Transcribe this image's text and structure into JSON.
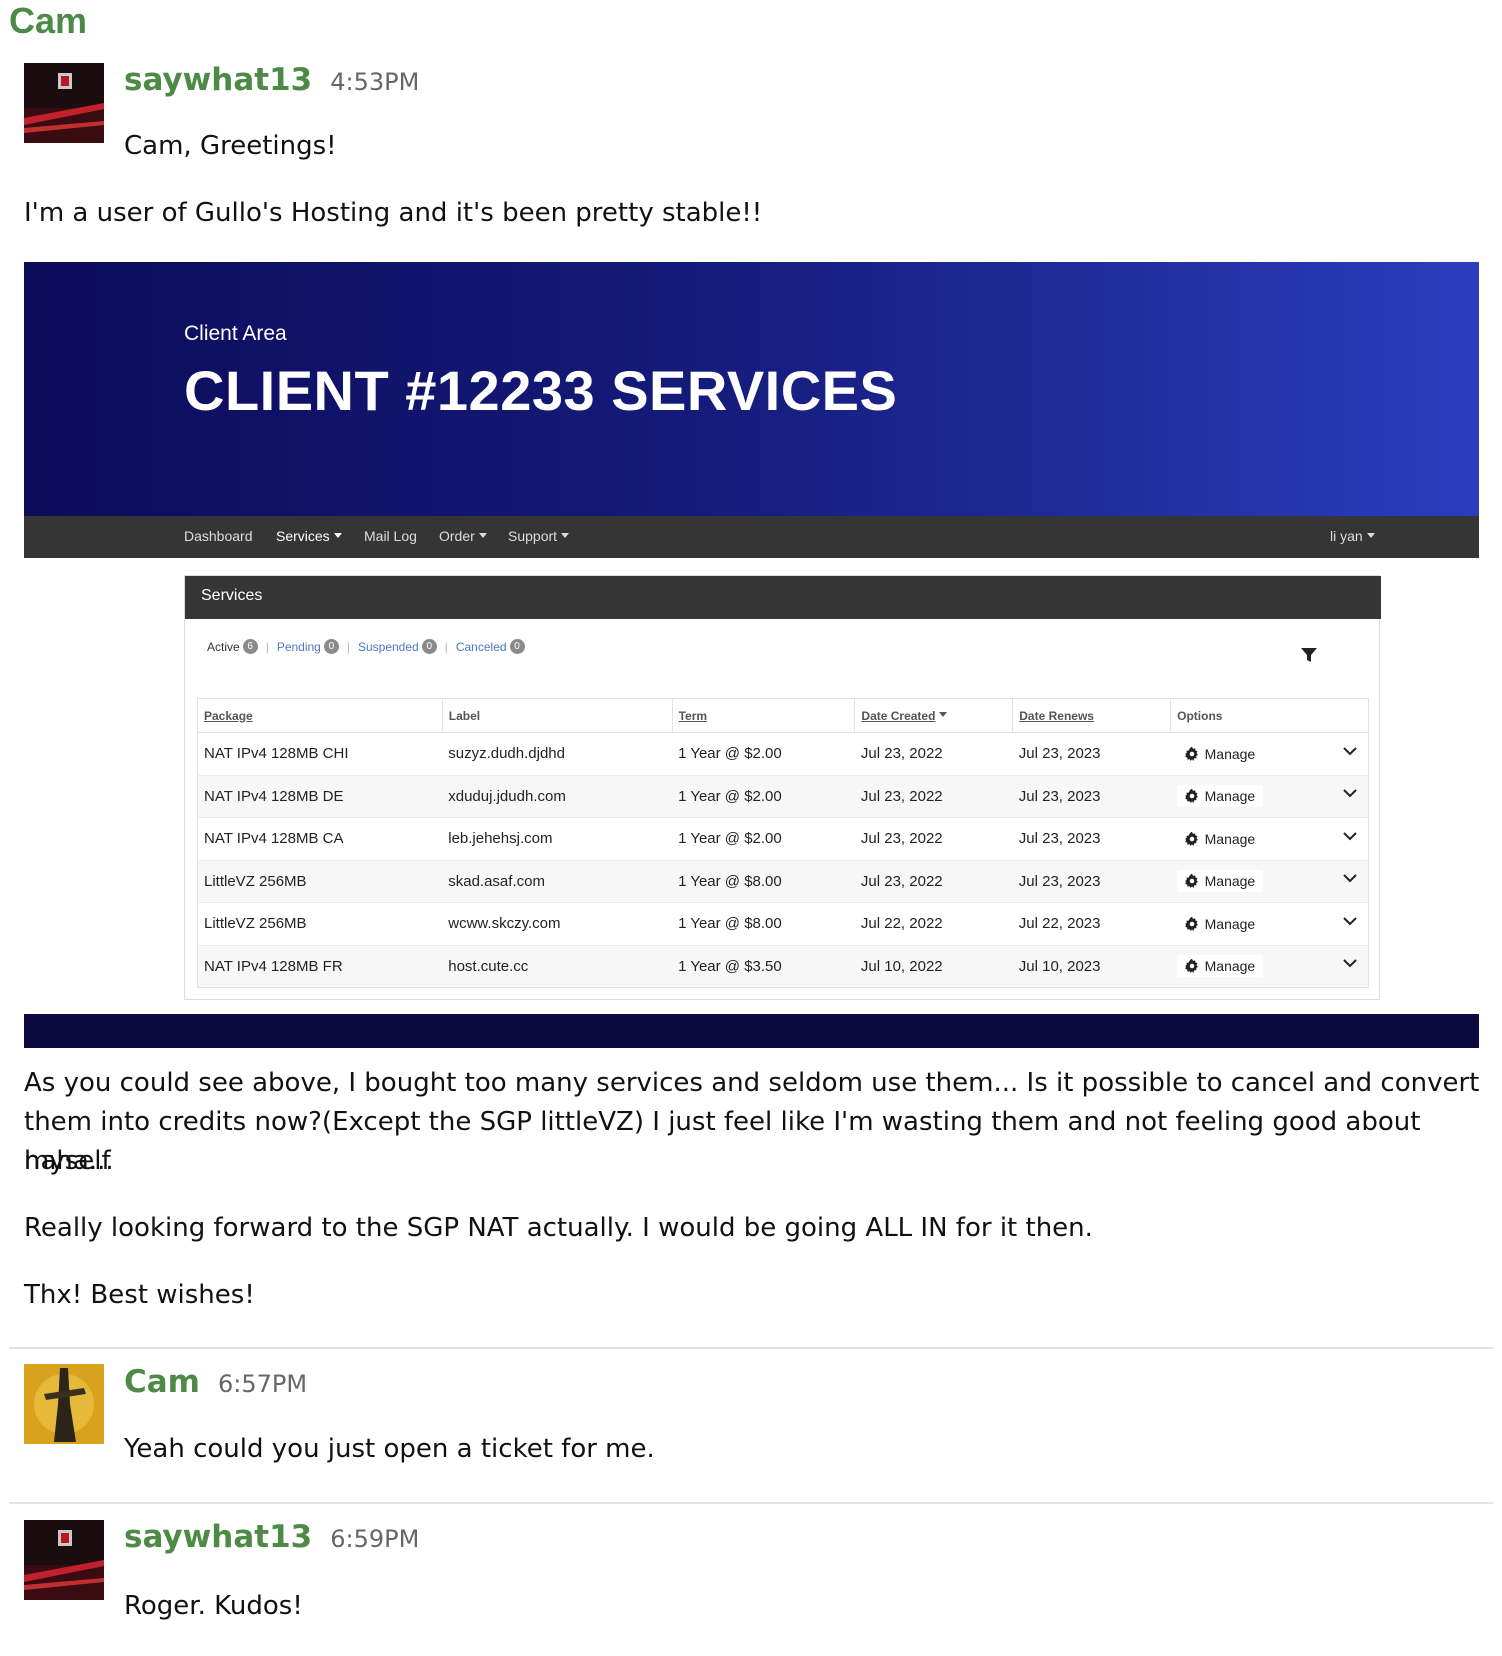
{
  "thread": {
    "title": "Cam"
  },
  "messages": [
    {
      "user": "saywhat13",
      "time": "4:53PM",
      "text": "Cam, Greetings!"
    },
    {
      "user": "Cam",
      "time": "6:57PM",
      "text": "Yeah could you just open a ticket for me."
    },
    {
      "user": "saywhat13",
      "time": "6:59PM",
      "text": "Roger. Kudos!"
    }
  ],
  "paragraphs": {
    "intro": "I'm a user of Gullo's Hosting and it's been pretty stable!!",
    "body1_line1": "As you could see above, I bought too many services and seldom use them... Is it possible to cancel and convert",
    "body1_line2": "them into credits now?(Except the SGP littleVZ) I just feel like I'm wasting them and not feeling good about myself",
    "body1_line3": "haha...",
    "body2": "Really looking forward to the SGP NAT actually. I would be going ALL IN for it then.",
    "body3": "Thx! Best wishes!"
  },
  "screenshot": {
    "subtitle": "Client Area",
    "title": "CLIENT #12233 SERVICES",
    "nav": [
      "Dashboard",
      "Services",
      "Mail Log",
      "Order",
      "Support"
    ],
    "user_menu": "li yan",
    "panel_title": "Services",
    "filters": [
      {
        "label": "Active",
        "count": "6"
      },
      {
        "label": "Pending",
        "count": "0"
      },
      {
        "label": "Suspended",
        "count": "0"
      },
      {
        "label": "Canceled",
        "count": "0"
      }
    ],
    "columns": [
      "Package",
      "Label",
      "Term",
      "Date Created",
      "Date Renews",
      "Options"
    ],
    "manage_label": "Manage",
    "rows": [
      {
        "package": "NAT IPv4 128MB CHI",
        "label": "suzyz.dudh.djdhd",
        "term": "1 Year @ $2.00",
        "created": "Jul 23, 2022",
        "renews": "Jul 23, 2023"
      },
      {
        "package": "NAT IPv4 128MB DE",
        "label": "xduduj.jdudh.com",
        "term": "1 Year @ $2.00",
        "created": "Jul 23, 2022",
        "renews": "Jul 23, 2023"
      },
      {
        "package": "NAT IPv4 128MB CA",
        "label": "leb.jehehsj.com",
        "term": "1 Year @ $2.00",
        "created": "Jul 23, 2022",
        "renews": "Jul 23, 2023"
      },
      {
        "package": "LittleVZ 256MB",
        "label": "skad.asaf.com",
        "term": "1 Year @ $8.00",
        "created": "Jul 23, 2022",
        "renews": "Jul 23, 2023"
      },
      {
        "package": "LittleVZ 256MB",
        "label": "wcww.skczy.com",
        "term": "1 Year @ $8.00",
        "created": "Jul 22, 2022",
        "renews": "Jul 22, 2023"
      },
      {
        "package": "NAT IPv4 128MB FR",
        "label": "host.cute.cc",
        "term": "1 Year @ $3.50",
        "created": "Jul 10, 2022",
        "renews": "Jul 10, 2023"
      }
    ]
  },
  "colors": {
    "username": "#4d8a45",
    "banner_start": "#0b0c5a",
    "banner_end": "#2b3dbd",
    "nav_bg": "#353535",
    "link": "#4a78c2"
  },
  "icons": [
    "avatar-image",
    "gear-icon",
    "chevron-down-icon",
    "filter-icon",
    "caret-down-icon"
  ]
}
